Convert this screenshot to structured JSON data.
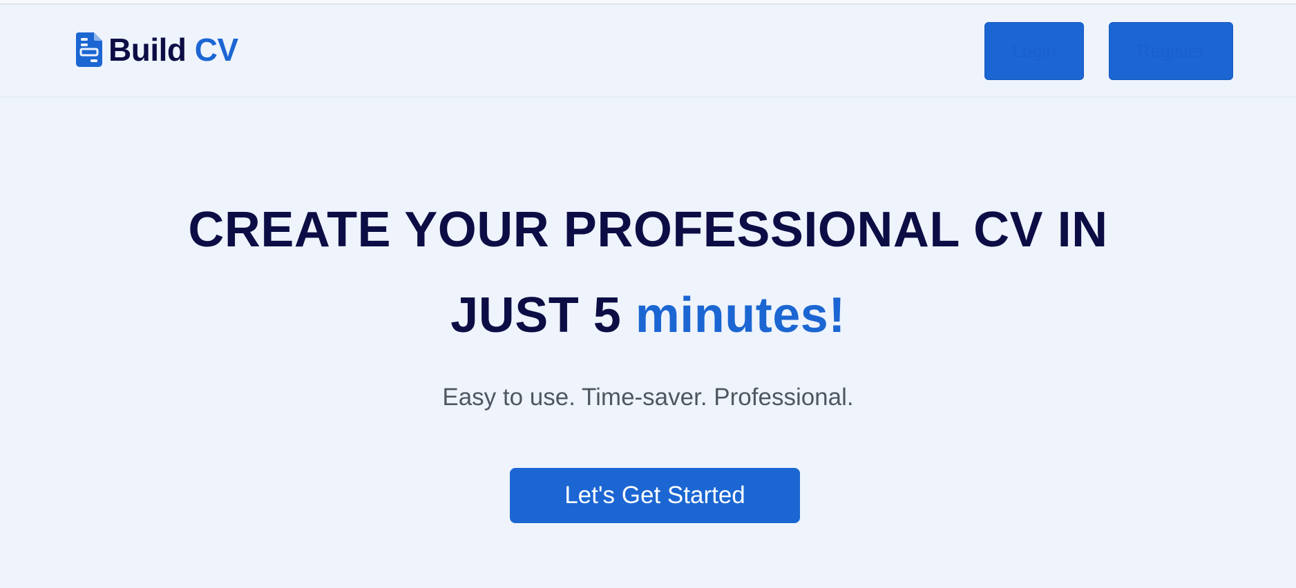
{
  "brand": {
    "icon": "document-icon",
    "name_part1": "Build",
    "name_part2": "CV"
  },
  "nav": {
    "login_label": "Login",
    "register_label": "Register"
  },
  "hero": {
    "line1": "CREATE YOUR PROFESSIONAL CV IN",
    "line2_prefix": "JUST 5",
    "line2_highlight": "minutes!",
    "tagline": "Easy to use. Time-saver. Professional.",
    "cta_label": "Let's Get Started"
  },
  "colors": {
    "background": "#eef3fc",
    "primary": "#1b66d2",
    "heading": "#0d0d45",
    "muted_text": "#4f5661"
  }
}
